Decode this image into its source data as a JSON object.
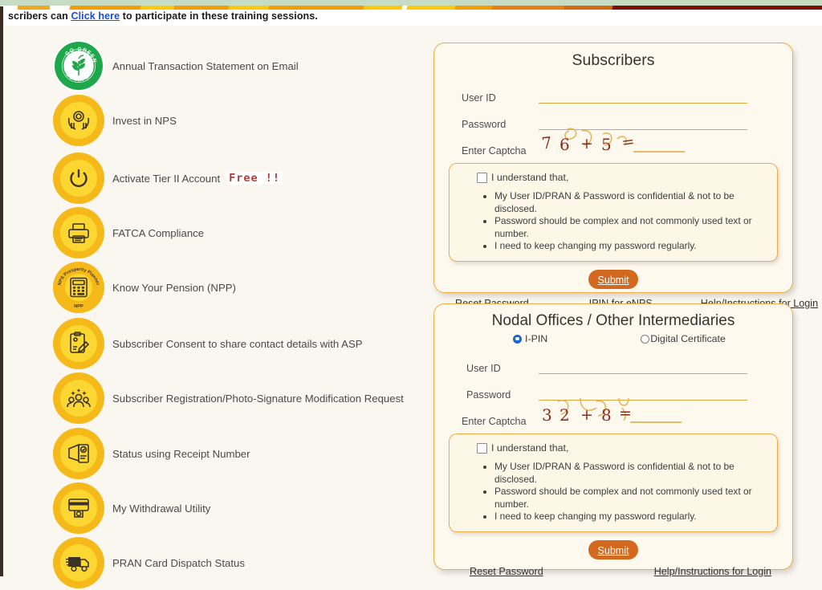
{
  "banner": {
    "stripe_colors": [
      "#ffffff",
      "#f59c00",
      "#fbcb0a",
      "#ffffff",
      "#fbcb0a",
      "#f59c00",
      "#e07714",
      "#cf6a11",
      "#7c1003"
    ],
    "sage_color": "#c8dbc3",
    "tab_color": "#f0a81e"
  },
  "notice": {
    "text_before": "scribers can ",
    "link_text": "Click here",
    "text_after": " to participate in these training sessions."
  },
  "services": {
    "items": [
      {
        "icon": "go-green-badge-icon",
        "label": "Annual Transaction Statement on Email",
        "tag": ""
      },
      {
        "icon": "hands-holding-coin-icon",
        "label": "Invest in NPS",
        "tag": ""
      },
      {
        "icon": "power-button-icon",
        "label": "Activate Tier II Account",
        "tag": "Free !!"
      },
      {
        "icon": "printer-icon",
        "label": "FATCA Compliance",
        "tag": ""
      },
      {
        "icon": "calculator-npp-icon",
        "label": "Know Your Pension (NPP)",
        "tag": ""
      },
      {
        "icon": "clipboard-pen-icon",
        "label": "Subscriber Consent to share contact details with ASP",
        "tag": ""
      },
      {
        "icon": "people-group-icon",
        "label": "Subscriber Registration/Photo-Signature Modification Request",
        "tag": ""
      },
      {
        "icon": "receipt-edit-icon",
        "label": "Status using Receipt Number",
        "tag": ""
      },
      {
        "icon": "atm-cash-icon",
        "label": "My Withdrawal Utility",
        "tag": ""
      },
      {
        "icon": "delivery-truck-icon",
        "label": "PRAN Card Dispatch Status",
        "tag": ""
      }
    ],
    "go_green_text_top": "GO GREEN",
    "go_green_text_bottom": "GO PAPERLESS",
    "npp_ring_text": "NPS Prosperity Planner",
    "npp_ring_label": "NPP"
  },
  "subscribers_panel": {
    "title": "Subscribers",
    "user_id_label": "User ID",
    "user_id_value": "",
    "password_label": "Password",
    "password_value": "",
    "captcha_label": "Enter Captcha",
    "captcha_question": "76 + 5 =",
    "captcha_digits": [
      "7",
      "6",
      "+",
      "5",
      "="
    ],
    "captcha_answer_value": "",
    "understand": {
      "title": "I understand that,",
      "checked": false,
      "bullets": [
        "My User ID/PRAN & Password is confidential & not to be disclosed.",
        "Password should be complex and not commonly used text or number.",
        "I need to keep changing my password regularly."
      ]
    },
    "submit_label": "Submit",
    "links": [
      "Reset Password",
      "IPIN for eNPS",
      "Help/Instructions for Login"
    ]
  },
  "nodal_panel": {
    "title": "Nodal Offices / Other Intermediaries",
    "login_modes": [
      {
        "label": "I-PIN",
        "selected": true
      },
      {
        "label": "Digital Certificate",
        "selected": false
      }
    ],
    "user_id_label": "User ID",
    "user_id_value": "",
    "password_label": "Password",
    "password_value": "",
    "captcha_label": "Enter Captcha",
    "captcha_question": "32 + 8 =",
    "captcha_digits": [
      "3",
      "2",
      "+",
      "8",
      "="
    ],
    "captcha_answer_value": "",
    "understand": {
      "title": "I understand that,",
      "checked": false,
      "bullets": [
        "My User ID/PRAN & Password is confidential & not to be disclosed.",
        "Password should be complex and not commonly used text or number.",
        "I need to keep changing my password regularly."
      ]
    },
    "submit_label": "Submit",
    "links": [
      "Reset Password",
      "Help/Instructions for Login"
    ]
  },
  "colors": {
    "page_bg": "#faf7f1",
    "panel_bg": "#fdf9ef",
    "panel_border": "#f0ac45",
    "inner_box_bg": "#fdf7e8",
    "submit_bg": "#d2691e",
    "icon_outer": "#f5b91a",
    "icon_inner": "#fcd731",
    "green_badge": "#1fa84b",
    "link_blue": "#1a4fd6",
    "radio_on": "#1567d3",
    "captcha_digit": "#8d2b17",
    "field_underline": "#dfa83c"
  }
}
